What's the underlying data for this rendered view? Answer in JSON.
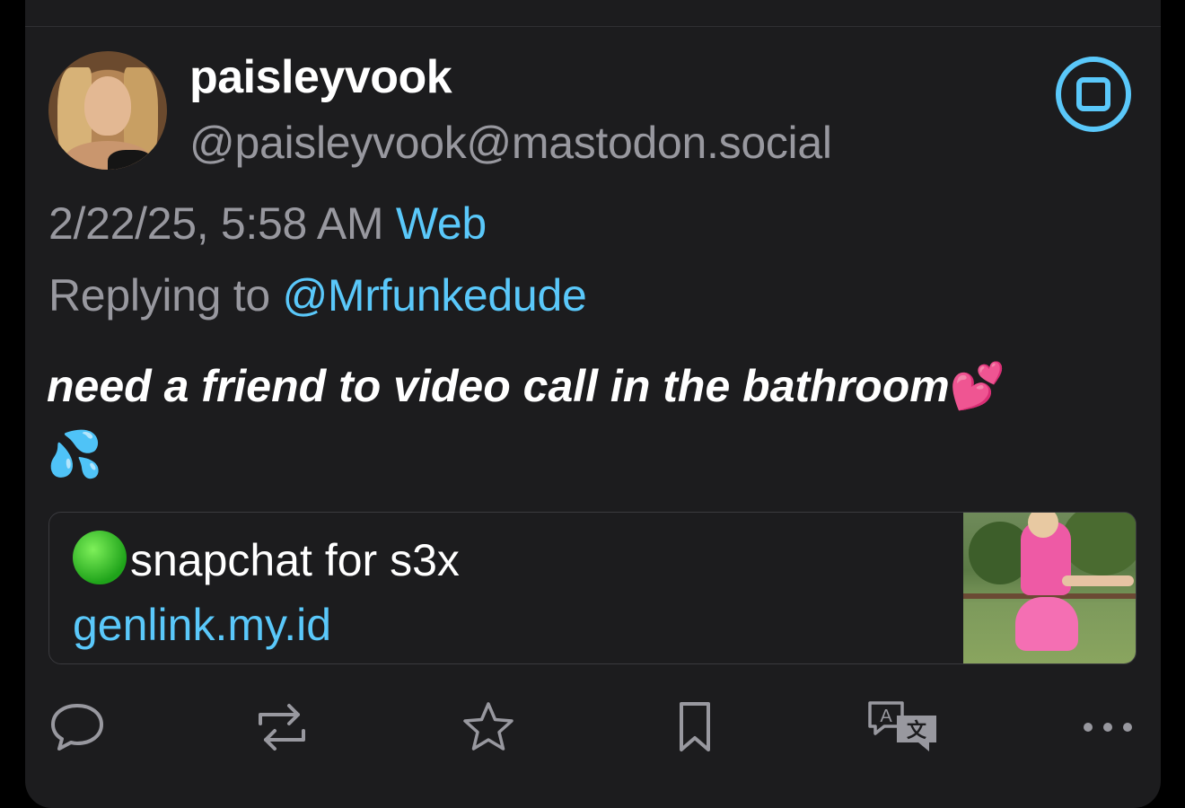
{
  "post": {
    "display_name": "paisleyvook",
    "handle": "@paisleyvook@mastodon.social",
    "timestamp": "2/22/25, 5:58 AM",
    "client": "Web",
    "reply_prefix": "Replying to",
    "reply_to": "@Mrfunkedude",
    "content_text": "need a friend to video call in the bathroom",
    "content_emoji_1": "💕",
    "content_emoji_2": "💦"
  },
  "link_card": {
    "title": "snapchat for s3x",
    "url": "genlink.my.id"
  },
  "actions": [
    {
      "icon": "reply-icon"
    },
    {
      "icon": "boost-icon"
    },
    {
      "icon": "favourite-icon"
    },
    {
      "icon": "bookmark-icon"
    },
    {
      "icon": "translate-icon"
    },
    {
      "icon": "more-icon"
    }
  ],
  "colors": {
    "background": "#1c1c1e",
    "accent": "#5ac8fa",
    "secondary_text": "#98989f",
    "primary_text": "#ffffff"
  }
}
